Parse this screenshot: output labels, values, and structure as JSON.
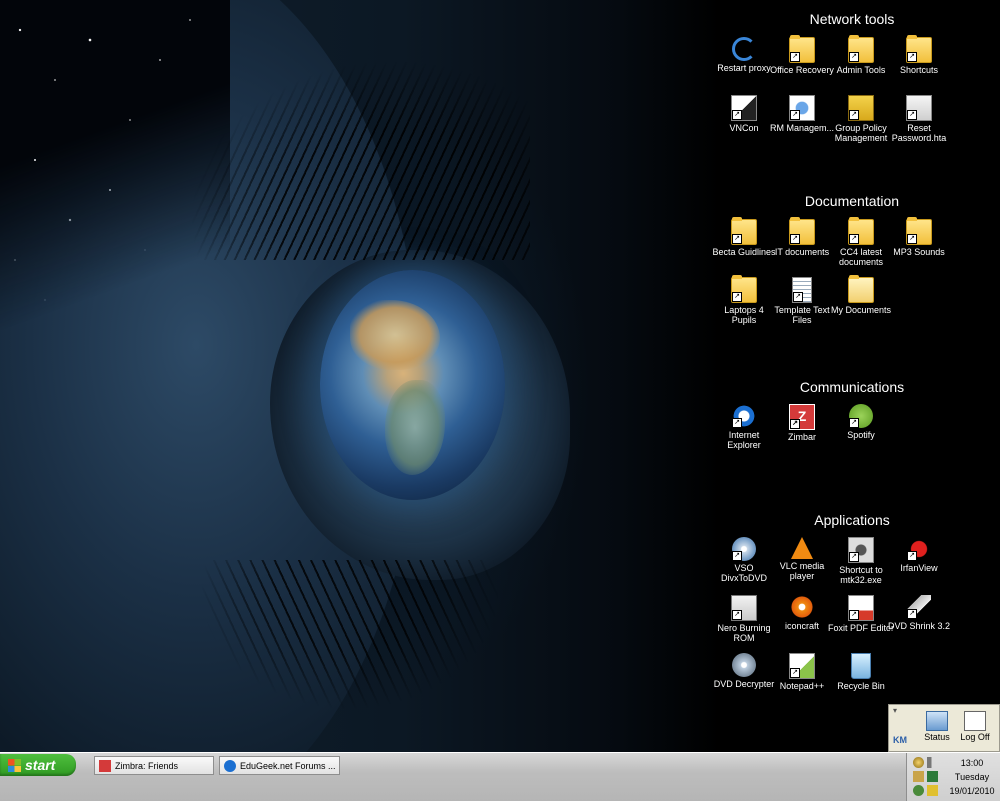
{
  "groups": {
    "network": {
      "title": "Network tools",
      "items": [
        "Restart proxy",
        "Office Recovery",
        "Admin Tools",
        "Shortcuts",
        "VNCon",
        "RM Managem...",
        "Group Policy Management",
        "Reset Password.hta"
      ]
    },
    "documentation": {
      "title": "Documentation",
      "items": [
        "Becta Guidlines",
        "IT documents",
        "CC4 latest documents",
        "MP3 Sounds",
        "Laptops 4 Pupils",
        "Template Text Files",
        "My Documents"
      ]
    },
    "communications": {
      "title": "Communications",
      "items": [
        "Internet Explorer",
        "Zimbar",
        "Spotify"
      ]
    },
    "applications": {
      "title": "Applications",
      "items": [
        "VSO DivxToDVD",
        "VLC media player",
        "Shortcut to mtk32.exe",
        "IrfanView",
        "Nero Burning ROM",
        "iconcraft",
        "Foxit PDF Editor",
        "DVD Shrink 3.2",
        "DVD Decrypter",
        "Notepad++",
        "Recycle Bin"
      ]
    }
  },
  "status_panel": {
    "status_label": "Status",
    "logoff_label": "Log Off",
    "logo": "KM"
  },
  "taskbar": {
    "start_label": "start",
    "tasks": [
      "Zimbra: Friends",
      "EduGeek.net Forums ..."
    ],
    "clock": {
      "time": "13:00",
      "day": "Tuesday",
      "date": "19/01/2010"
    }
  },
  "colors": {
    "start_green": "#3aa82a",
    "taskbar": "#c8c8c8",
    "zimbra_red": "#d43a3a",
    "spotify_green": "#7cc142",
    "ie_blue": "#1b6fd1"
  }
}
